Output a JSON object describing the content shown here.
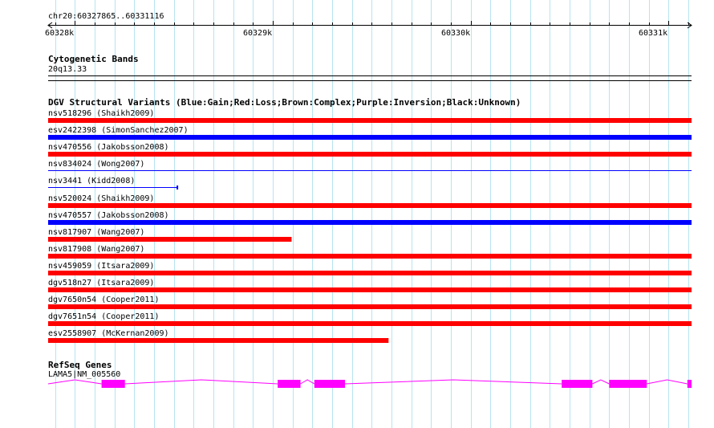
{
  "ruler": {
    "location": "chr20:60327865..60331116",
    "ticks": [
      {
        "label": "60328k",
        "pos": 60328000
      },
      {
        "label": "60329k",
        "pos": 60329000
      },
      {
        "label": "60330k",
        "pos": 60330000
      },
      {
        "label": "60331k",
        "pos": 60331000
      }
    ],
    "start": 60327865,
    "end": 60331116
  },
  "cytobands": {
    "title": "Cytogenetic Bands",
    "band": "20q13.33"
  },
  "dgv": {
    "title": "DGV Structural Variants (Blue:Gain;Red:Loss;Brown:Complex;Purple:Inversion;Black:Unknown)",
    "colors": {
      "gain": "#0000ff",
      "loss": "#ff0000"
    },
    "variants": [
      {
        "label": "nsv518296 (Shaikh2009)",
        "type": "loss",
        "style": "thick",
        "start": 60327865,
        "end": 60331116
      },
      {
        "label": "esv2422398 (SimonSanchez2007)",
        "type": "gain",
        "style": "thick",
        "start": 60327865,
        "end": 60331116
      },
      {
        "label": "nsv470556 (Jakobsson2008)",
        "type": "loss",
        "style": "thick",
        "start": 60327865,
        "end": 60331116
      },
      {
        "label": "nsv834024 (Wong2007)",
        "type": "gain",
        "style": "thin",
        "start": 60327865,
        "end": 60331116
      },
      {
        "label": "nsv3441 (Kidd2008)",
        "type": "gain",
        "style": "thin-end",
        "start": 60327865,
        "end": 60328518
      },
      {
        "label": "nsv520024 (Shaikh2009)",
        "type": "loss",
        "style": "thick",
        "start": 60327865,
        "end": 60331116
      },
      {
        "label": "nsv470557 (Jakobsson2008)",
        "type": "gain",
        "style": "thick",
        "start": 60327865,
        "end": 60331116
      },
      {
        "label": "nsv817907 (Wang2007)",
        "type": "loss",
        "style": "thick",
        "start": 60327865,
        "end": 60329095
      },
      {
        "label": "nsv817908 (Wang2007)",
        "type": "loss",
        "style": "thick",
        "start": 60327865,
        "end": 60331116
      },
      {
        "label": "nsv459059 (Itsara2009)",
        "type": "loss",
        "style": "thick",
        "start": 60327865,
        "end": 60331116
      },
      {
        "label": "dgv518n27 (Itsara2009)",
        "type": "loss",
        "style": "thick",
        "start": 60327865,
        "end": 60331116
      },
      {
        "label": "dgv7650n54 (Cooper2011)",
        "type": "loss",
        "style": "thick",
        "start": 60327865,
        "end": 60331116
      },
      {
        "label": "dgv7651n54 (Cooper2011)",
        "type": "loss",
        "style": "thick",
        "start": 60327865,
        "end": 60331116
      },
      {
        "label": "esv2558907 (McKernan2009)",
        "type": "loss",
        "style": "thick",
        "start": 60327865,
        "end": 60329585
      }
    ]
  },
  "refseq": {
    "title": "RefSeq Genes",
    "gene_label": "LAMA5|NM_005560",
    "color": "#ff00ff",
    "exons": [
      {
        "start": 60328135,
        "end": 60328253
      },
      {
        "start": 60329025,
        "end": 60329140
      },
      {
        "start": 60329210,
        "end": 60329365
      },
      {
        "start": 60330460,
        "end": 60330615
      },
      {
        "start": 60330700,
        "end": 60330890
      },
      {
        "start": 60331095,
        "end": 60331116
      }
    ]
  }
}
